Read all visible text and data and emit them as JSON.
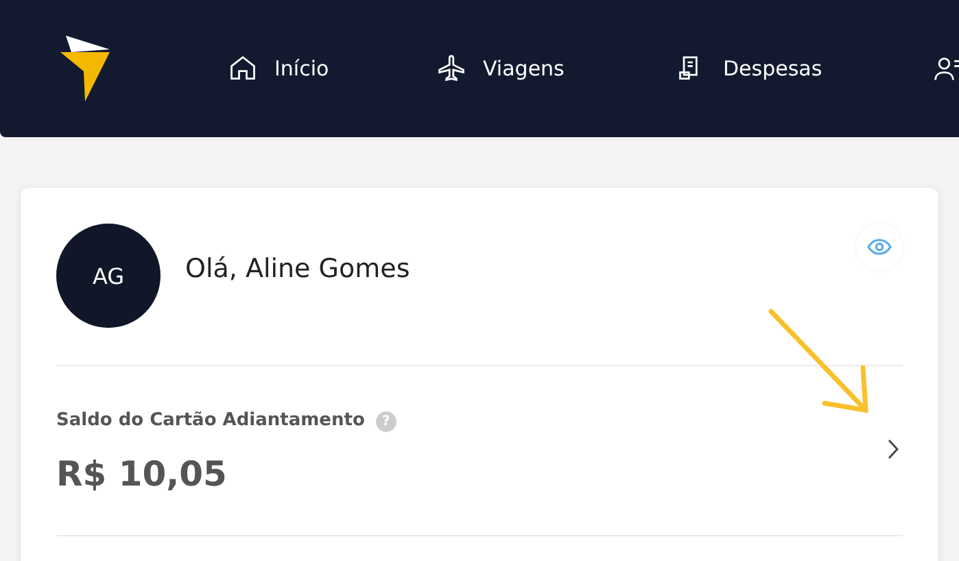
{
  "nav": {
    "items": [
      {
        "label": "Início",
        "kind": "home",
        "selected": false
      },
      {
        "label": "Viagens",
        "kind": "plane",
        "selected": false
      },
      {
        "label": "Despesas",
        "kind": "receipt",
        "selected": false
      },
      {
        "kind": "users",
        "selected": false
      }
    ]
  },
  "profile": {
    "initials": "AG",
    "greeting": "Olá, Aline Gomes"
  },
  "balance": {
    "label": "Saldo do Cartão Adiantamento",
    "help": "?",
    "amount": "R$ 10,05"
  }
}
